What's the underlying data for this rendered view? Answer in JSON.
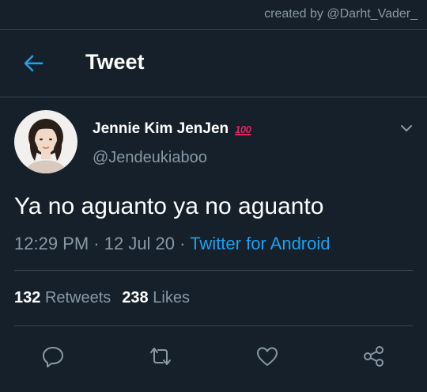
{
  "watermark": "created by @Darht_Vader_",
  "header": {
    "title": "Tweet",
    "back_icon": "arrow-left-icon"
  },
  "tweet": {
    "author_name": "Jennie Kim JenJen",
    "emoji": "100",
    "author_handle": "@Jendeukiaboo",
    "text": "Ya no aguanto ya no aguanto",
    "time": "12:29 PM",
    "sep1": " · ",
    "date": "12 Jul 20",
    "sep2": " · ",
    "source": "Twitter for Android"
  },
  "stats": {
    "retweets_count": "132",
    "retweets_label": "Retweets",
    "likes_count": "238",
    "likes_label": "Likes"
  },
  "actions": [
    "reply-icon",
    "retweet-icon",
    "like-icon",
    "share-icon"
  ],
  "colors": {
    "background": "#15202b",
    "divider": "#38444d",
    "secondary_text": "#8899a6",
    "accent": "#1da1f2",
    "emoji_red": "#e0245e"
  }
}
